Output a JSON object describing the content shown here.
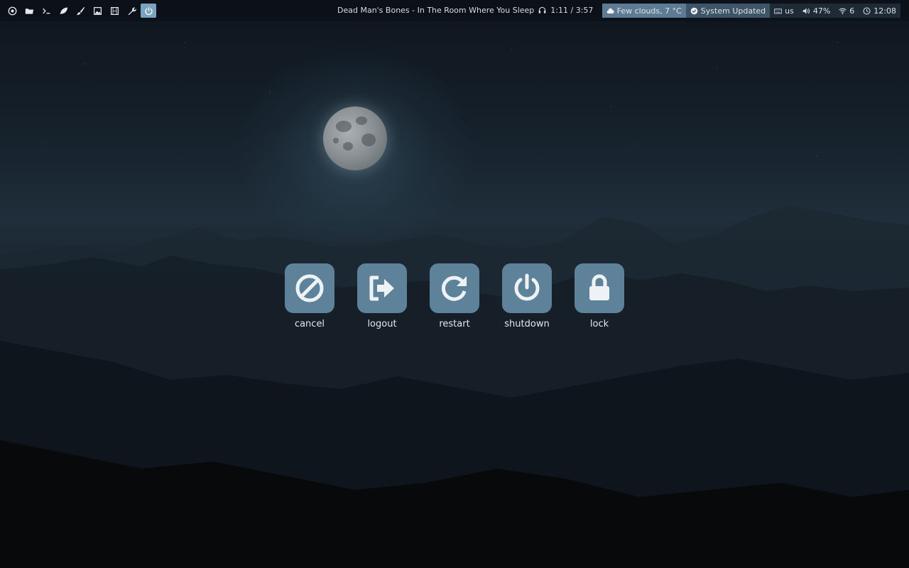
{
  "topbar": {
    "launchers": [
      {
        "name": "chrome-icon"
      },
      {
        "name": "folder-icon"
      },
      {
        "name": "terminal-icon"
      },
      {
        "name": "leaf-icon"
      },
      {
        "name": "paintbrush-icon"
      },
      {
        "name": "image-icon"
      },
      {
        "name": "film-icon"
      },
      {
        "name": "wrench-icon"
      },
      {
        "name": "power-icon",
        "active": true
      }
    ],
    "now_playing": {
      "title": "Dead Man's Bones - In The Room Where You Sleep",
      "time": "1:11 / 3:57"
    },
    "tray": {
      "weather": "Few clouds, 7 °C",
      "updates": "System Updated",
      "keyboard": "us",
      "volume": "47%",
      "wifi": "6",
      "clock": "12:08"
    },
    "colors": {
      "accent": "#7aa3bf",
      "weather_bg": "#5d7b92"
    }
  },
  "dialog": {
    "actions": [
      {
        "id": "cancel",
        "label": "cancel",
        "icon": "cancel-icon"
      },
      {
        "id": "logout",
        "label": "logout",
        "icon": "logout-icon"
      },
      {
        "id": "restart",
        "label": "restart",
        "icon": "restart-icon"
      },
      {
        "id": "shutdown",
        "label": "shutdown",
        "icon": "shutdown-icon"
      },
      {
        "id": "lock",
        "label": "lock",
        "icon": "lock-icon"
      }
    ],
    "button_color": "#5e8299"
  }
}
